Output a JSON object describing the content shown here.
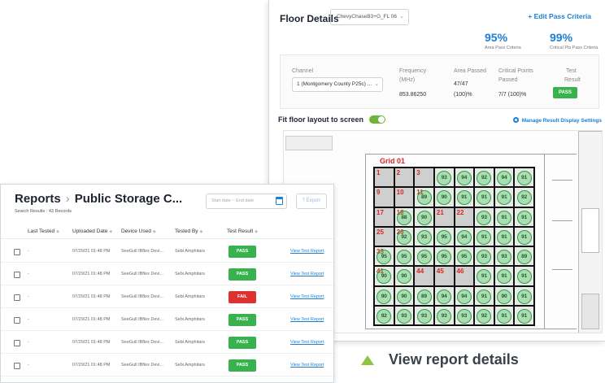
{
  "floor_details": {
    "title": "Floor Details",
    "floor_select": "ChevyChaseB3+G_FL 06",
    "edit_link": "+ Edit Pass Criteria",
    "area_pass_pct": "95%",
    "area_pass_label": "Area Pass Criteria",
    "critical_pass_pct": "99%",
    "critical_pass_label": "Critical Pts Pass Criteria",
    "table": {
      "channel_header": "Channel",
      "channel_value": "1 (Montgomery County P25c) ...",
      "frequency_header": "Frequency",
      "frequency_unit": "(MHz)",
      "frequency_value": "853.86250",
      "area_header": "Area Passed",
      "area_value_1": "47/47",
      "area_value_2": "(100)%",
      "critical_header_1": "Critical Points",
      "critical_header_2": "Passed",
      "critical_value": "7/7 (100)%",
      "test_header_1": "Test",
      "test_header_2": "Result",
      "test_value": "PASS"
    },
    "fit_label": "Fit floor layout to screen",
    "fit_enabled": true,
    "manage_link": "Manage Result Display Settings",
    "grid": {
      "title": "Grid 01",
      "cells": [
        {
          "n": "1",
          "v": ""
        },
        {
          "n": "2",
          "v": ""
        },
        {
          "n": "3",
          "v": ""
        },
        {
          "n": "",
          "v": "93"
        },
        {
          "n": "",
          "v": "94"
        },
        {
          "n": "",
          "v": "92"
        },
        {
          "n": "",
          "v": "94"
        },
        {
          "n": "",
          "v": "91"
        },
        {
          "n": "9",
          "v": ""
        },
        {
          "n": "10",
          "v": ""
        },
        {
          "n": "11",
          "v": "89"
        },
        {
          "n": "",
          "v": "90"
        },
        {
          "n": "",
          "v": "91"
        },
        {
          "n": "",
          "v": "91"
        },
        {
          "n": "",
          "v": "91"
        },
        {
          "n": "",
          "v": "92"
        },
        {
          "n": "17",
          "v": ""
        },
        {
          "n": "18",
          "v": "88"
        },
        {
          "n": "",
          "v": "90"
        },
        {
          "n": "21",
          "v": ""
        },
        {
          "n": "22",
          "v": ""
        },
        {
          "n": "",
          "v": "93"
        },
        {
          "n": "",
          "v": "91"
        },
        {
          "n": "",
          "v": "91"
        },
        {
          "n": "25",
          "v": ""
        },
        {
          "n": "26",
          "v": "92"
        },
        {
          "n": "",
          "v": "93"
        },
        {
          "n": "",
          "v": "95"
        },
        {
          "n": "",
          "v": "94"
        },
        {
          "n": "",
          "v": "91"
        },
        {
          "n": "",
          "v": "91"
        },
        {
          "n": "",
          "v": "91"
        },
        {
          "n": "33",
          "v": "95"
        },
        {
          "n": "",
          "v": "95"
        },
        {
          "n": "",
          "v": "95"
        },
        {
          "n": "",
          "v": "95"
        },
        {
          "n": "",
          "v": "95"
        },
        {
          "n": "",
          "v": "93"
        },
        {
          "n": "",
          "v": "93"
        },
        {
          "n": "",
          "v": "89"
        },
        {
          "n": "41",
          "v": "90"
        },
        {
          "n": "",
          "v": "90"
        },
        {
          "n": "44",
          "v": ""
        },
        {
          "n": "45",
          "v": ""
        },
        {
          "n": "46",
          "v": ""
        },
        {
          "n": "",
          "v": "91"
        },
        {
          "n": "",
          "v": "91"
        },
        {
          "n": "",
          "v": "91"
        },
        {
          "n": "",
          "v": "90"
        },
        {
          "n": "",
          "v": "90"
        },
        {
          "n": "",
          "v": "89"
        },
        {
          "n": "",
          "v": "94"
        },
        {
          "n": "",
          "v": "94"
        },
        {
          "n": "",
          "v": "91"
        },
        {
          "n": "",
          "v": "90"
        },
        {
          "n": "",
          "v": "91"
        },
        {
          "n": "",
          "v": "92"
        },
        {
          "n": "",
          "v": "93"
        },
        {
          "n": "",
          "v": "93"
        },
        {
          "n": "",
          "v": "93"
        },
        {
          "n": "",
          "v": "93"
        },
        {
          "n": "",
          "v": "92"
        },
        {
          "n": "",
          "v": "91"
        },
        {
          "n": "",
          "v": "91"
        }
      ]
    }
  },
  "caption": "View report details",
  "reports": {
    "title": "Reports",
    "breadcrumb": "Public Storage C...",
    "search_results": "Search Results : 43 Records",
    "date_placeholder": "Start date ~ End date",
    "export_label": "Export",
    "columns": [
      "Last Tested",
      "Uploaded Date",
      "Device Used",
      "Tested By",
      "Test Result"
    ],
    "rows": [
      {
        "last": "-",
        "uploaded": "07/29/21 01:48 PM",
        "device": "SeeGull IBflex Devi...",
        "tester": "Sebi Amphitars",
        "result": "PASS",
        "link": "View Test Report"
      },
      {
        "last": "-",
        "uploaded": "07/29/21 01:48 PM",
        "device": "SeeGull IBflex Devi...",
        "tester": "Sebi Amphitars",
        "result": "PASS",
        "link": "View Test Report"
      },
      {
        "last": "-",
        "uploaded": "07/29/21 01:48 PM",
        "device": "SeeGull IBflex Devi...",
        "tester": "Sebi Amphitars",
        "result": "FAIL",
        "link": "View Test Report"
      },
      {
        "last": "-",
        "uploaded": "07/29/21 01:48 PM",
        "device": "SeeGull IBflex Devi...",
        "tester": "Sebi Amphitars",
        "result": "PASS",
        "link": "View Test Report"
      },
      {
        "last": "-",
        "uploaded": "07/29/21 01:48 PM",
        "device": "SeeGull IBflex Devi...",
        "tester": "Sebi Amphitars",
        "result": "PASS",
        "link": "View Test Report"
      },
      {
        "last": "-",
        "uploaded": "07/29/21 01:48 PM",
        "device": "SeeGull IBflex Devi...",
        "tester": "Sebi Amphitars",
        "result": "PASS",
        "link": "View Test Report"
      }
    ]
  },
  "colors": {
    "accent": "#1c7ed6",
    "pass": "#37b24d",
    "fail": "#e03131",
    "caption_icon": "#8cc63f",
    "toggle": "#6fb33b"
  },
  "icons": {
    "edit": "plus-icon",
    "manage": "gear-icon",
    "date": "calendar-icon",
    "export": "upload-icon",
    "caption": "triangle-up-icon"
  }
}
